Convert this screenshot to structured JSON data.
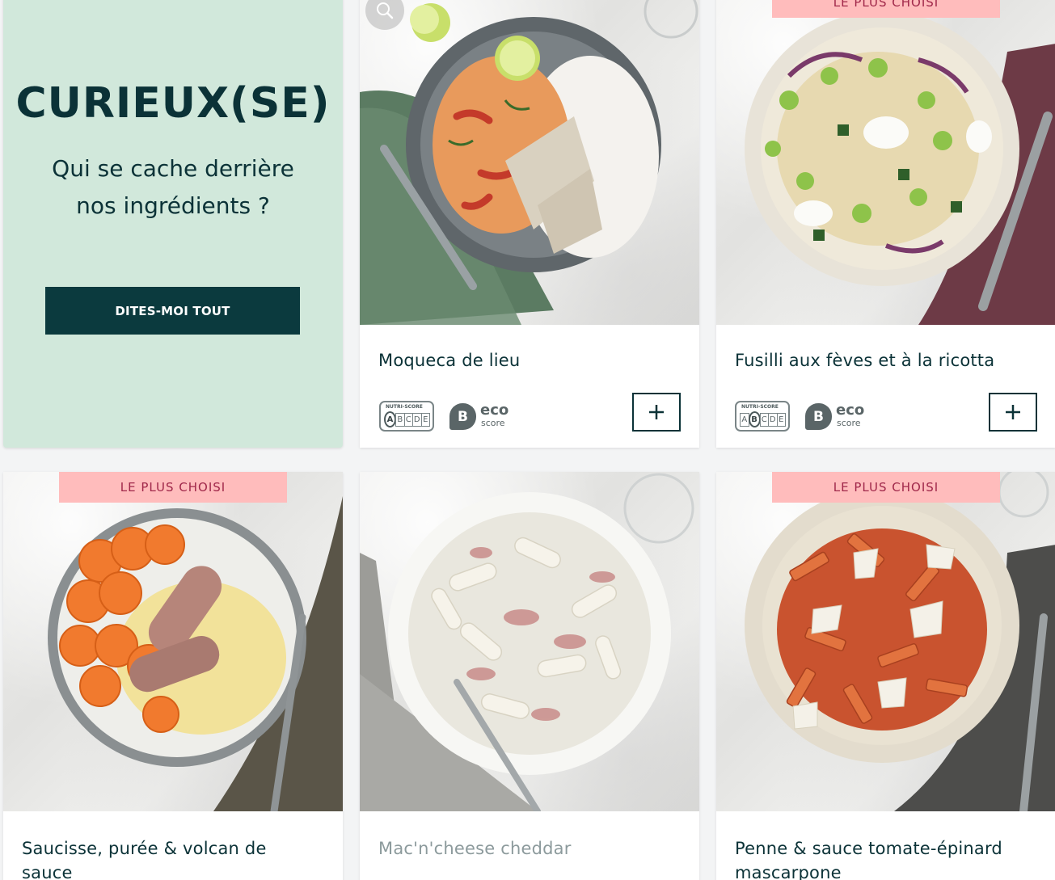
{
  "promo": {
    "title": "CURIEUX(SE)",
    "subtitle_line1": "Qui se cache derrière",
    "subtitle_line2": "nos ingrédients ?",
    "button_label": "DITES-MOI TOUT",
    "background": "#d1e8db",
    "button_color": "#0b3a3e"
  },
  "badge_label": "LE PLUS CHOISI",
  "colors": {
    "text": "#0b3237",
    "badge_bg": "#ffbcbc",
    "badge_text": "#a0284a",
    "page_bg": "#f3f4f5"
  },
  "nutriscore": {
    "label": "NUTRI-SCORE",
    "letters": [
      "A",
      "B",
      "C",
      "D",
      "E"
    ]
  },
  "ecoscore": {
    "eco": "eco",
    "score": "score"
  },
  "recipes": [
    {
      "title": "Moqueca de lieu",
      "nutri_score": "A",
      "eco_score": "B",
      "badge": false,
      "icon": "zoom-icon"
    },
    {
      "title": "Fusilli aux fèves et à la ricotta",
      "nutri_score": "B",
      "eco_score": "B",
      "badge": true
    },
    {
      "title_line1": "Saucisse, purée & volcan de",
      "title_line2": "sauce",
      "badge": true
    },
    {
      "title": "Mac'n'cheese cheddar",
      "badge": false
    },
    {
      "title_line1": "Penne & sauce tomate-épinard",
      "title_line2": "mascarpone",
      "badge": true
    }
  ]
}
